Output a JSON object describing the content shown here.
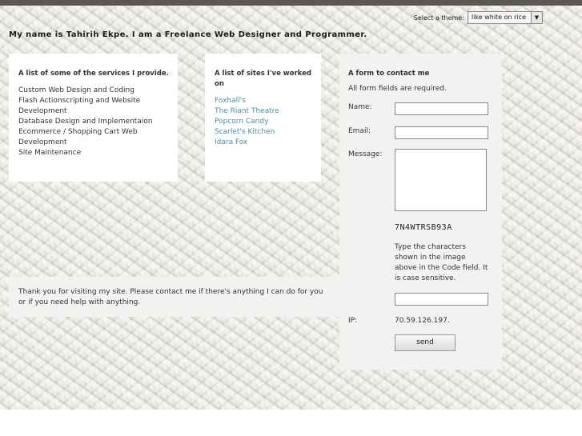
{
  "theme": {
    "label": "Select a theme:",
    "selected": "like white on rice"
  },
  "headline": "My name is Tahirih Ekpe. I am a Freelance Web Designer and Programmer.",
  "services": {
    "title": "A list of some of the services I provide.",
    "items": [
      "Custom Web Design and Coding",
      "Flash Actionscripting and Website Development",
      "Database Design and Implementaion",
      "Ecommerce / Shopping Cart Web Development",
      "Site Maintenance"
    ]
  },
  "sites": {
    "title": "A list of sites I've worked on",
    "items": [
      "Foxhall's",
      "The Riant Theatre",
      "Popcorn Candy",
      "Scarlet's Kitchen",
      "Idara Fox"
    ]
  },
  "thanks": "Thank you for visiting my site. Please contact me if there's anything I can do for you or if you need help with anything.",
  "form": {
    "title": "A form to contact me",
    "required": "All form fields are required.",
    "name_label": "Name:",
    "email_label": "Email:",
    "message_label": "Message:",
    "captcha": "7N4WTRSB93A",
    "hint": "Type the characters shown in the image above in the Code field. It is case sensitive.",
    "ip_label": "IP:",
    "ip_value": "70.59.126.197.",
    "send_label": "send"
  }
}
